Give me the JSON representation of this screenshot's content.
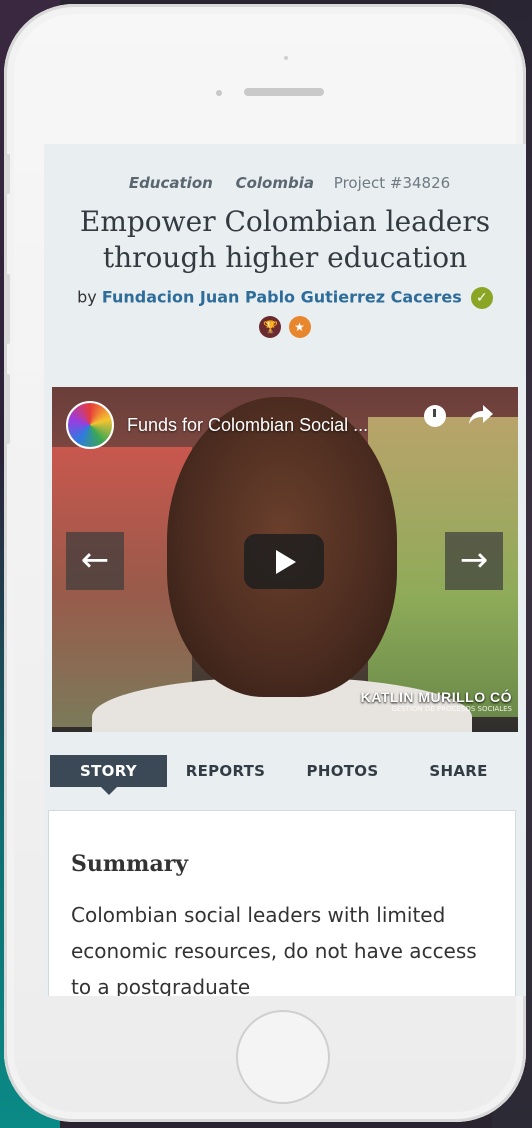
{
  "project": {
    "categories": [
      "Education",
      "Colombia"
    ],
    "project_id": "Project #34826",
    "title": "Empower Colombian leaders through higher education",
    "by_label": "by",
    "organization": "Fundacion Juan Pablo Gutierrez Caceres",
    "verified_icon": "check-icon",
    "badges": [
      "trophy-icon",
      "star-icon"
    ]
  },
  "video": {
    "title": "Funds for Colombian Social ...",
    "caption_name": "KATLIN MURILLO CÓ",
    "caption_role": "GESTION DE PROCESOS SOCIALES",
    "prev_arrow": "←",
    "next_arrow": "→"
  },
  "tabs": [
    {
      "label": "STORY",
      "active": true
    },
    {
      "label": "REPORTS",
      "active": false
    },
    {
      "label": "PHOTOS",
      "active": false
    },
    {
      "label": "SHARE",
      "active": false
    }
  ],
  "summary": {
    "heading": "Summary",
    "text": "Colombian social leaders with limited economic resources, do not have access to a postgraduate"
  },
  "colors": {
    "accent": "#2e6c9a",
    "verified": "#8aa624",
    "tab_active": "#3b4957"
  }
}
